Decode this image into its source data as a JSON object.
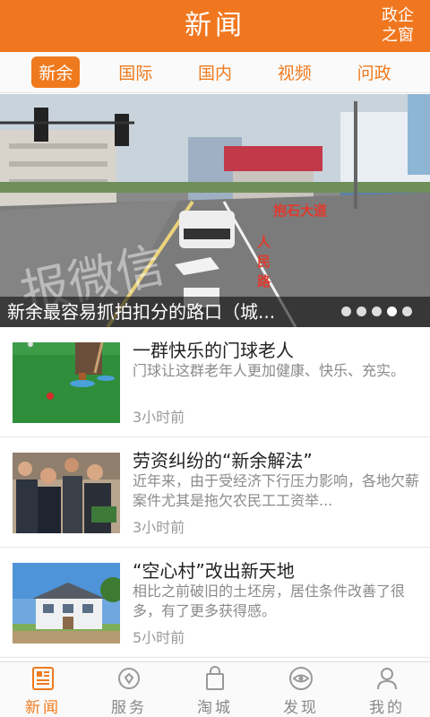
{
  "header": {
    "title": "新闻",
    "side_link": "政企之窗"
  },
  "tabs": [
    {
      "label": "新余",
      "active": true
    },
    {
      "label": "国际",
      "active": false
    },
    {
      "label": "国内",
      "active": false
    },
    {
      "label": "视频",
      "active": false
    },
    {
      "label": "问政",
      "active": false
    }
  ],
  "banner": {
    "caption": "新余最容易抓拍扣分的路口（城...",
    "photo_labels": {
      "road_sign": "抱石大道",
      "vertical_label": "人民路",
      "watermark": "报微信"
    },
    "slide_count": 5,
    "active_slide": 4
  },
  "news": [
    {
      "title": "一群快乐的门球老人",
      "desc": "门球让这群老年人更加健康、快乐、充实。",
      "time": "3小时前",
      "thumb": "croquet-photo"
    },
    {
      "title": "劳资纠纷的“新余解法”",
      "desc": "近年来，由于受经济下行压力影响，各地欠薪案件尤其是拖欠农民工工资举...",
      "time": "3小时前",
      "thumb": "crowd-photo"
    },
    {
      "title": "“空心村”改出新天地",
      "desc": "相比之前破旧的土坯房，居住条件改善了很多，有了更多获得感。",
      "time": "5小时前",
      "thumb": "house-photo"
    }
  ],
  "bottom_nav": [
    {
      "label": "新闻",
      "icon": "newspaper-icon",
      "active": true
    },
    {
      "label": "服务",
      "icon": "service-icon",
      "active": false
    },
    {
      "label": "淘城",
      "icon": "shopping-bag-icon",
      "active": false
    },
    {
      "label": "发现",
      "icon": "eye-icon",
      "active": false
    },
    {
      "label": "我的",
      "icon": "user-icon",
      "active": false
    }
  ],
  "colors": {
    "brand": "#f0771f",
    "inactive": "#888888"
  }
}
